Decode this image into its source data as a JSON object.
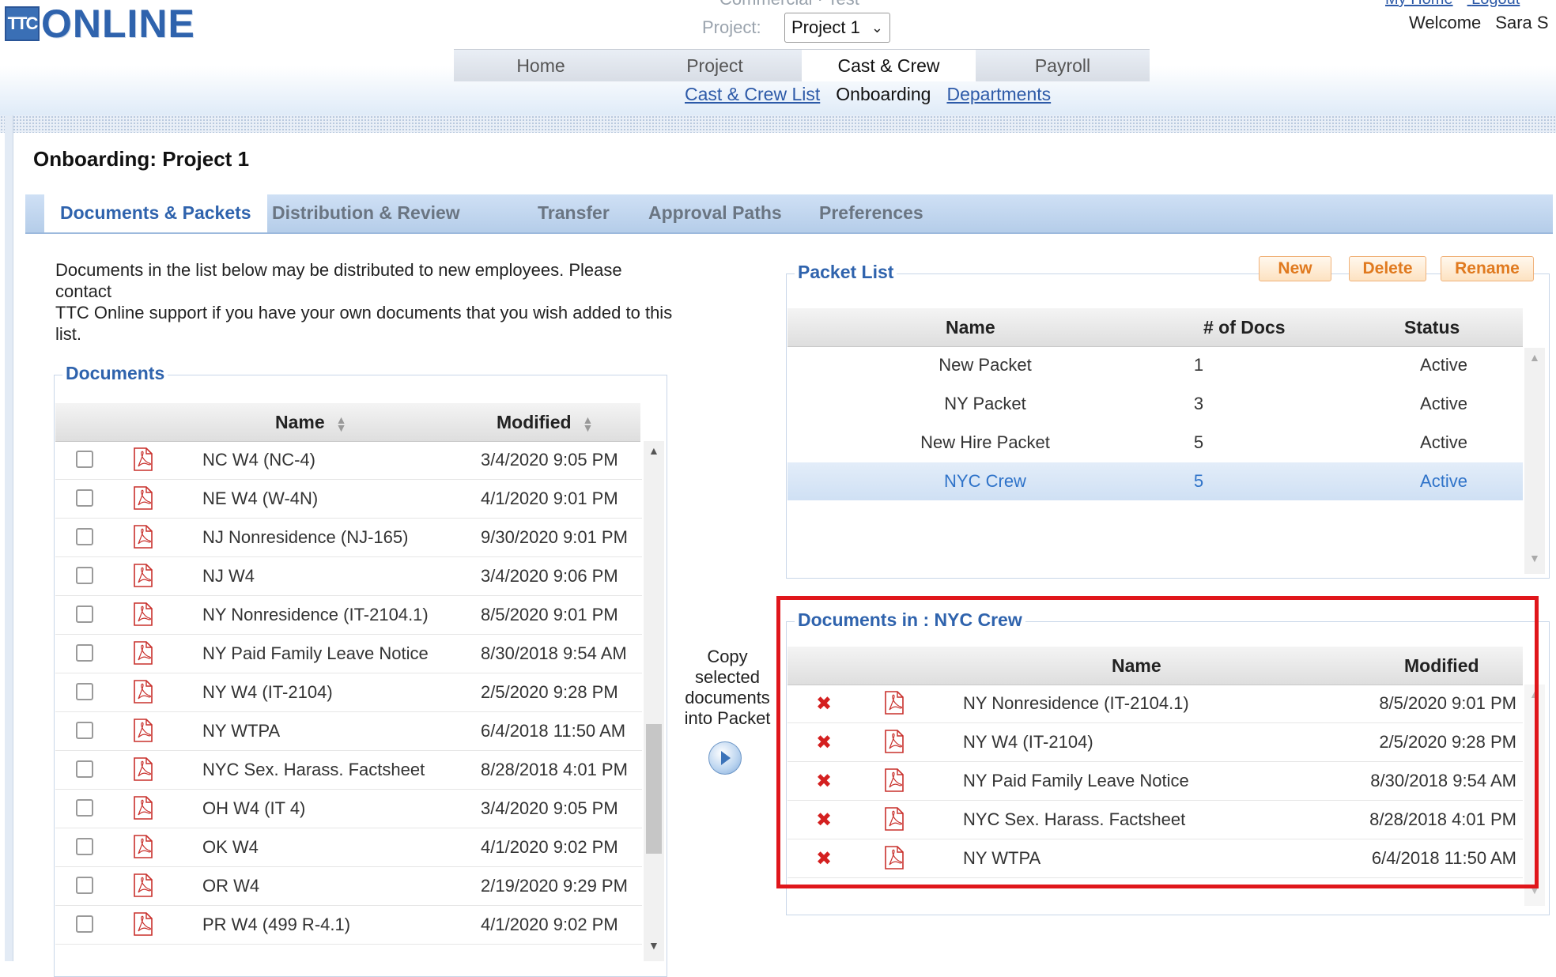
{
  "header": {
    "logo_mark": "TTC",
    "logo_word": "ONLINE",
    "company_crumb": "Commercial · Test",
    "project_label": "Project:",
    "project_value": "Project 1",
    "top_links": [
      "My Home",
      "Logout"
    ],
    "welcome_label": "Welcome",
    "welcome_user": "Sara S"
  },
  "main_nav": [
    {
      "label": "Home",
      "active": false
    },
    {
      "label": "Project",
      "active": false
    },
    {
      "label": "Cast & Crew",
      "active": true
    },
    {
      "label": "Payroll",
      "active": false
    }
  ],
  "sub_nav": [
    {
      "label": "Cast & Crew List",
      "link": true
    },
    {
      "label": "Onboarding",
      "link": false
    },
    {
      "label": "Departments",
      "link": true
    }
  ],
  "page": {
    "title": "Onboarding: Project 1"
  },
  "tabs": [
    {
      "label": "Documents & Packets",
      "active": true
    },
    {
      "label": "Distribution & Review",
      "active": false
    },
    {
      "label": "Transfer",
      "active": false
    },
    {
      "label": "Approval Paths",
      "active": false
    },
    {
      "label": "Preferences",
      "active": false
    }
  ],
  "intro": {
    "line1": "Documents in the list below may be distributed to new employees. Please",
    "line2": "contact",
    "line3": "TTC Online support if you have your own documents that you wish added to this",
    "line4": "list."
  },
  "documents": {
    "legend": "Documents",
    "columns": {
      "name": "Name",
      "modified": "Modified"
    },
    "rows": [
      {
        "name": "NC W4 (NC-4)",
        "modified": "3/4/2020 9:05 PM"
      },
      {
        "name": "NE W4 (W-4N)",
        "modified": "4/1/2020 9:01 PM"
      },
      {
        "name": "NJ Nonresidence (NJ-165)",
        "modified": "9/30/2020 9:01 PM"
      },
      {
        "name": "NJ W4",
        "modified": "3/4/2020 9:06 PM"
      },
      {
        "name": "NY Nonresidence (IT-2104.1)",
        "modified": "8/5/2020 9:01 PM"
      },
      {
        "name": "NY Paid Family Leave Notice",
        "modified": "8/30/2018 9:54 AM"
      },
      {
        "name": "NY W4 (IT-2104)",
        "modified": "2/5/2020 9:28 PM"
      },
      {
        "name": "NY WTPA",
        "modified": "6/4/2018 11:50 AM"
      },
      {
        "name": "NYC Sex. Harass. Factsheet",
        "modified": "8/28/2018 4:01 PM"
      },
      {
        "name": "OH W4 (IT 4)",
        "modified": "3/4/2020 9:05 PM"
      },
      {
        "name": "OK W4",
        "modified": "4/1/2020 9:02 PM"
      },
      {
        "name": "OR W4",
        "modified": "2/19/2020 9:29 PM"
      },
      {
        "name": "PR W4 (499 R-4.1)",
        "modified": "4/1/2020 9:02 PM"
      }
    ]
  },
  "copy_widget": {
    "line1": "Copy",
    "line2": "selected",
    "line3": "documents",
    "line4": "into Packet"
  },
  "packets": {
    "legend": "Packet List",
    "buttons": {
      "new": "New",
      "delete": "Delete",
      "rename": "Rename"
    },
    "columns": {
      "name": "Name",
      "docs": "# of Docs",
      "status": "Status"
    },
    "rows": [
      {
        "name": "New Packet",
        "docs": "1",
        "status": "Active",
        "selected": false
      },
      {
        "name": "NY Packet",
        "docs": "3",
        "status": "Active",
        "selected": false
      },
      {
        "name": "New Hire Packet",
        "docs": "5",
        "status": "Active",
        "selected": false
      },
      {
        "name": "NYC Crew",
        "docs": "5",
        "status": "Active",
        "selected": true
      }
    ]
  },
  "packet_docs": {
    "legend": "Documents in : NYC Crew",
    "columns": {
      "name": "Name",
      "modified": "Modified"
    },
    "rows": [
      {
        "name": "NY Nonresidence (IT-2104.1)",
        "modified": "8/5/2020 9:01 PM"
      },
      {
        "name": "NY W4 (IT-2104)",
        "modified": "2/5/2020 9:28 PM"
      },
      {
        "name": "NY Paid Family Leave Notice",
        "modified": "8/30/2018 9:54 AM"
      },
      {
        "name": "NYC Sex. Harass. Factsheet",
        "modified": "8/28/2018 4:01 PM"
      },
      {
        "name": "NY WTPA",
        "modified": "6/4/2018 11:50 AM"
      }
    ]
  },
  "icons": {
    "pdf": "pdf-file-icon",
    "delete": "remove-x-icon",
    "copy": "arrow-right-circle-icon",
    "dropdown": "chevron-down-icon"
  },
  "colors": {
    "brand": "#2f63ad",
    "highlight": "#e0161b",
    "button_text": "#e07a1f",
    "selected_row_text": "#2f73c9"
  }
}
